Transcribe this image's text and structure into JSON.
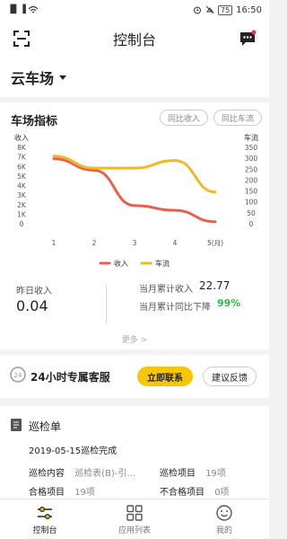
{
  "status_bar": {
    "time": "16:50",
    "battery": "75",
    "signal": "▐▌▐"
  },
  "header": {
    "title": "控制台"
  },
  "farm": {
    "name": "云车场"
  },
  "indicators": {
    "title": "车场指标",
    "btn_income_yoy": "同比收入",
    "btn_flow_yoy": "同比车流",
    "more": "更多 >"
  },
  "chart_data": {
    "type": "line",
    "categories": [
      "1",
      "2",
      "3",
      "4",
      "5(月)"
    ],
    "ylabel_left": "收入",
    "ylabel_right": "车流",
    "yticks_left": [
      "8K",
      "7K",
      "6K",
      "5K",
      "4K",
      "3K",
      "2K",
      "1K",
      "0"
    ],
    "yticks_right": [
      "350",
      "300",
      "250",
      "200",
      "150",
      "100",
      "50",
      "0"
    ],
    "ylim_left": [
      0,
      8000
    ],
    "ylim_right": [
      0,
      350
    ],
    "legend_position": "bottom",
    "series": [
      {
        "name": "收入",
        "axis": "left",
        "color": "#e8604c",
        "values": [
          6800,
          5600,
          1900,
          1400,
          200
        ]
      },
      {
        "name": "车流",
        "axis": "right",
        "color": "#f0b92b",
        "values": [
          310,
          255,
          255,
          290,
          145
        ]
      }
    ]
  },
  "stats": {
    "yesterday_label": "昨日收入",
    "yesterday_value": "0.04",
    "month_label": "当月累计收入",
    "month_value": "22.77",
    "yoy_label": "当月累计同比下降",
    "yoy_value": "99%"
  },
  "service": {
    "icon_text": "24",
    "title": "24小时专属客服",
    "contact_btn": "立即联系",
    "feedback_btn": "建议反馈"
  },
  "inspection": {
    "title": "巡检单",
    "status": "2019-05-15巡检完成",
    "rows": [
      [
        {
          "label": "巡检内容",
          "value": "巡检表(B)-引..."
        },
        {
          "label": "巡检项目",
          "value": "19项"
        }
      ],
      [
        {
          "label": "合格项目",
          "value": "19项"
        },
        {
          "label": "不合格项目",
          "value": "0项"
        }
      ]
    ]
  },
  "nav": {
    "items": [
      {
        "label": "控制台",
        "icon": "sliders-icon",
        "active": true
      },
      {
        "label": "应用列表",
        "icon": "grid-icon",
        "active": false
      },
      {
        "label": "我的",
        "icon": "smile-icon",
        "active": false
      }
    ]
  }
}
